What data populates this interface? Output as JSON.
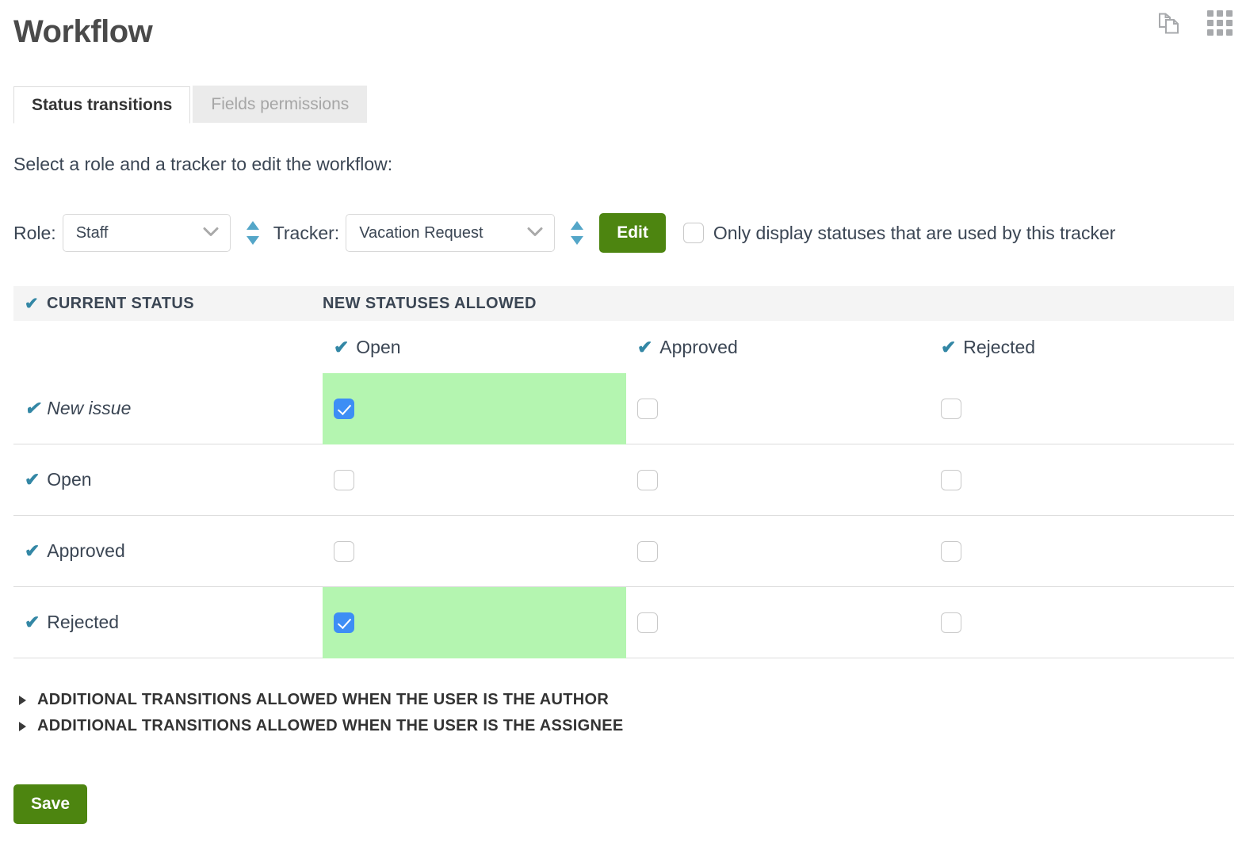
{
  "header": {
    "title": "Workflow",
    "icons": [
      {
        "name": "copy-pages-icon"
      },
      {
        "name": "apps-grid-icon"
      }
    ]
  },
  "tabs": [
    {
      "label": "Status transitions",
      "active": true
    },
    {
      "label": "Fields permissions",
      "active": false
    }
  ],
  "intro": "Select a role and a tracker to edit the workflow:",
  "controls": {
    "role_label": "Role:",
    "role_value": "Staff",
    "tracker_label": "Tracker:",
    "tracker_value": "Vacation Request",
    "edit_label": "Edit",
    "only_display_label": "Only display statuses that are used by this tracker",
    "only_display_checked": false
  },
  "table": {
    "header": {
      "current_status": "CURRENT STATUS",
      "new_statuses_allowed": "NEW STATUSES ALLOWED"
    },
    "columns": [
      "Open",
      "Approved",
      "Rejected"
    ],
    "rows": [
      {
        "status": "New issue",
        "italic": true,
        "cells": [
          true,
          false,
          false
        ]
      },
      {
        "status": "Open",
        "italic": false,
        "cells": [
          false,
          false,
          false
        ]
      },
      {
        "status": "Approved",
        "italic": false,
        "cells": [
          false,
          false,
          false
        ]
      },
      {
        "status": "Rejected",
        "italic": false,
        "cells": [
          true,
          false,
          false
        ]
      }
    ]
  },
  "disclosures": [
    "ADDITIONAL TRANSITIONS ALLOWED WHEN THE USER IS THE AUTHOR",
    "ADDITIONAL TRANSITIONS ALLOWED WHEN THE USER IS THE ASSIGNEE"
  ],
  "save_label": "Save",
  "colors": {
    "accent_green": "#4d8510",
    "highlight_green": "#b4f5b0",
    "checkbox_blue": "#3d8ef5",
    "tick_teal": "#3387a5",
    "header_band": "#f4f4f4"
  }
}
